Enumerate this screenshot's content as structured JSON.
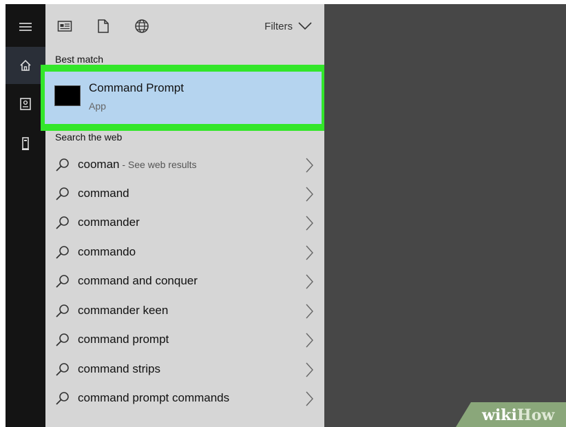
{
  "rail": {
    "items": [
      {
        "icon": "hamburger-menu-icon"
      },
      {
        "icon": "home-icon",
        "active": true
      },
      {
        "icon": "notebook-icon"
      },
      {
        "icon": "tower-device-icon"
      }
    ]
  },
  "topbar": {
    "icons": [
      "apps-filter-icon",
      "documents-filter-icon",
      "web-filter-icon"
    ],
    "filters_label": "Filters"
  },
  "best_match": {
    "section_label": "Best match",
    "title": "Command Prompt",
    "subtitle": "App",
    "highlight_color": "#33e62a",
    "selected_bg": "#b5d4ef"
  },
  "web": {
    "section_label": "Search the web",
    "results": [
      {
        "text": "cooman",
        "suffix": " - See web results"
      },
      {
        "text": "command",
        "suffix": ""
      },
      {
        "text": "commander",
        "suffix": ""
      },
      {
        "text": "commando",
        "suffix": ""
      },
      {
        "text": "command and conquer",
        "suffix": ""
      },
      {
        "text": "commander keen",
        "suffix": ""
      },
      {
        "text": "command prompt",
        "suffix": ""
      },
      {
        "text": "command strips",
        "suffix": ""
      },
      {
        "text": "command prompt commands",
        "suffix": ""
      }
    ]
  },
  "watermark": {
    "text_wiki": "wiki",
    "text_how": "How"
  }
}
